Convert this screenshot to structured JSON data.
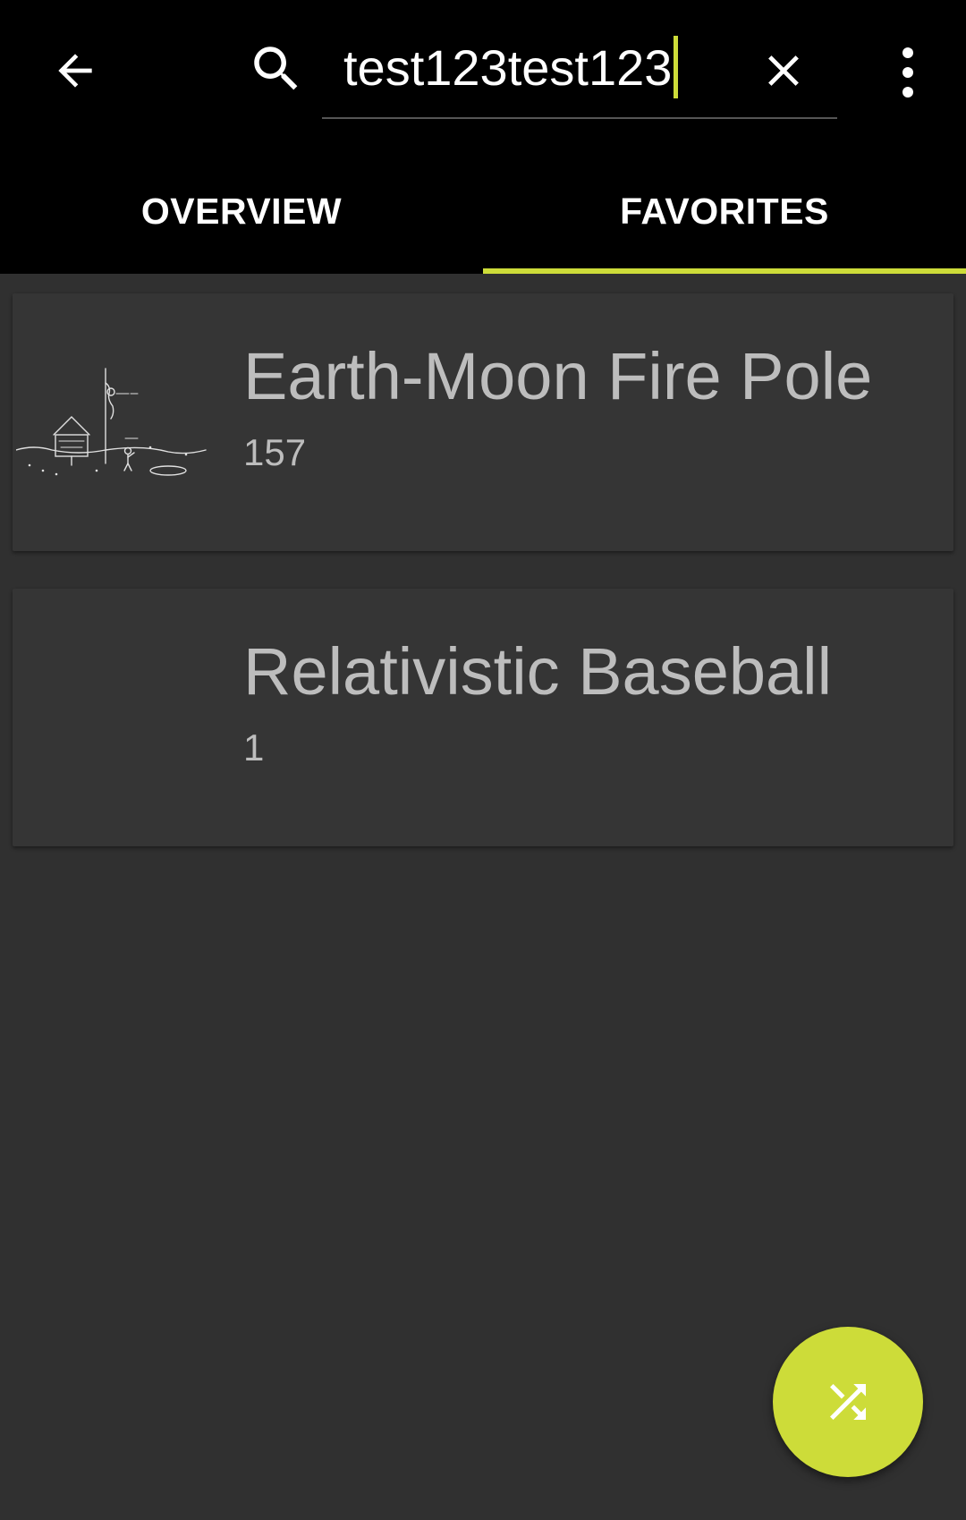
{
  "toolbar": {
    "back_icon": "arrow-back-icon",
    "search_icon": "search-icon",
    "search_value": "test123test123",
    "clear_icon": "close-icon",
    "more_icon": "more-vert-icon"
  },
  "tabs": [
    {
      "label": "OVERVIEW",
      "selected": false
    },
    {
      "label": "FAVORITES",
      "selected": true
    }
  ],
  "favorites": [
    {
      "title": "Earth-Moon Fire Pole",
      "number": "157",
      "thumbnail": "comic-thumbnail"
    },
    {
      "title": "Relativistic Baseball",
      "number": "1",
      "thumbnail": ""
    }
  ],
  "fab": {
    "icon": "shuffle-icon"
  },
  "colors": {
    "accent": "#cddc39",
    "appbar": "#000000",
    "background": "#303030",
    "card": "#353535",
    "card_text": "#bdbdbd"
  }
}
